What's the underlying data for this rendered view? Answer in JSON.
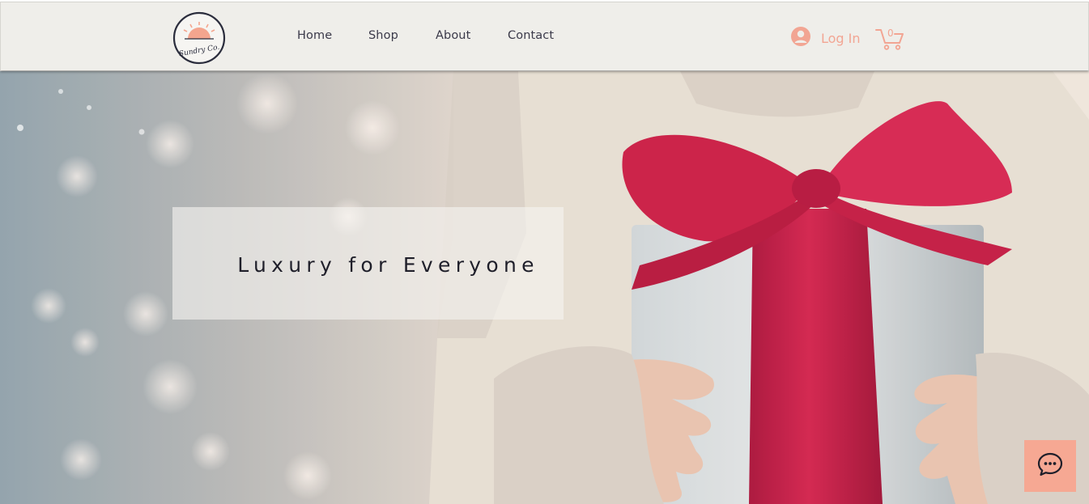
{
  "brand": {
    "logo_text": "Sundry Co."
  },
  "nav": {
    "items": [
      {
        "label": "Home"
      },
      {
        "label": "Shop"
      },
      {
        "label": "About"
      },
      {
        "label": "Contact"
      }
    ]
  },
  "account": {
    "login_label": "Log In",
    "cart_count": "0"
  },
  "hero": {
    "headline": "Luxury for Everyone"
  },
  "colors": {
    "accent": "#f2a593",
    "header_bg": "#efeeea",
    "ribbon": "#c8163f",
    "chat_bg": "#f6a893"
  },
  "icons": {
    "logo": "sunset-logo-icon",
    "user": "user-avatar-icon",
    "cart": "shopping-cart-icon",
    "chat": "chat-bubble-icon"
  }
}
